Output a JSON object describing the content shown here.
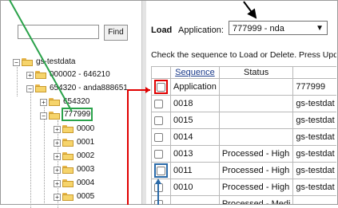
{
  "search": {
    "find_label": "Find",
    "value": ""
  },
  "tree": {
    "root": "gs-testdata",
    "items": [
      {
        "label": "000002 - 646210"
      },
      {
        "label": "654320 - anda888651"
      },
      {
        "label": "654320"
      },
      {
        "label": "777999"
      },
      {
        "label": "0000"
      },
      {
        "label": "0001"
      },
      {
        "label": "0002"
      },
      {
        "label": "0003"
      },
      {
        "label": "0004"
      },
      {
        "label": "0005"
      }
    ]
  },
  "load": {
    "title": "Load",
    "app_label": "Application:",
    "app_value": "777999 - nda",
    "instructions": "Check the sequence to Load or Delete. Press Upd"
  },
  "table": {
    "headers": [
      "",
      "Sequence",
      "Status",
      ""
    ],
    "rows": [
      {
        "seq": "Application",
        "status": "",
        "source": "777999"
      },
      {
        "seq": "0018",
        "status": "",
        "source": "gs-testdat"
      },
      {
        "seq": "0015",
        "status": "",
        "source": "gs-testdat"
      },
      {
        "seq": "0014",
        "status": "",
        "source": "gs-testdat"
      },
      {
        "seq": "0013",
        "status": "Processed - High",
        "source": "gs-testdat"
      },
      {
        "seq": "0011",
        "status": "Processed - High",
        "source": "gs-testdat"
      },
      {
        "seq": "0010",
        "status": "Processed - High",
        "source": "gs-testdat"
      },
      {
        "seq": "",
        "status": "Processed - Medi",
        "source": ""
      }
    ]
  },
  "colors": {
    "highlight_green": "#2aa24a",
    "highlight_red": "#e00000",
    "highlight_blue": "#2a6aa8"
  }
}
